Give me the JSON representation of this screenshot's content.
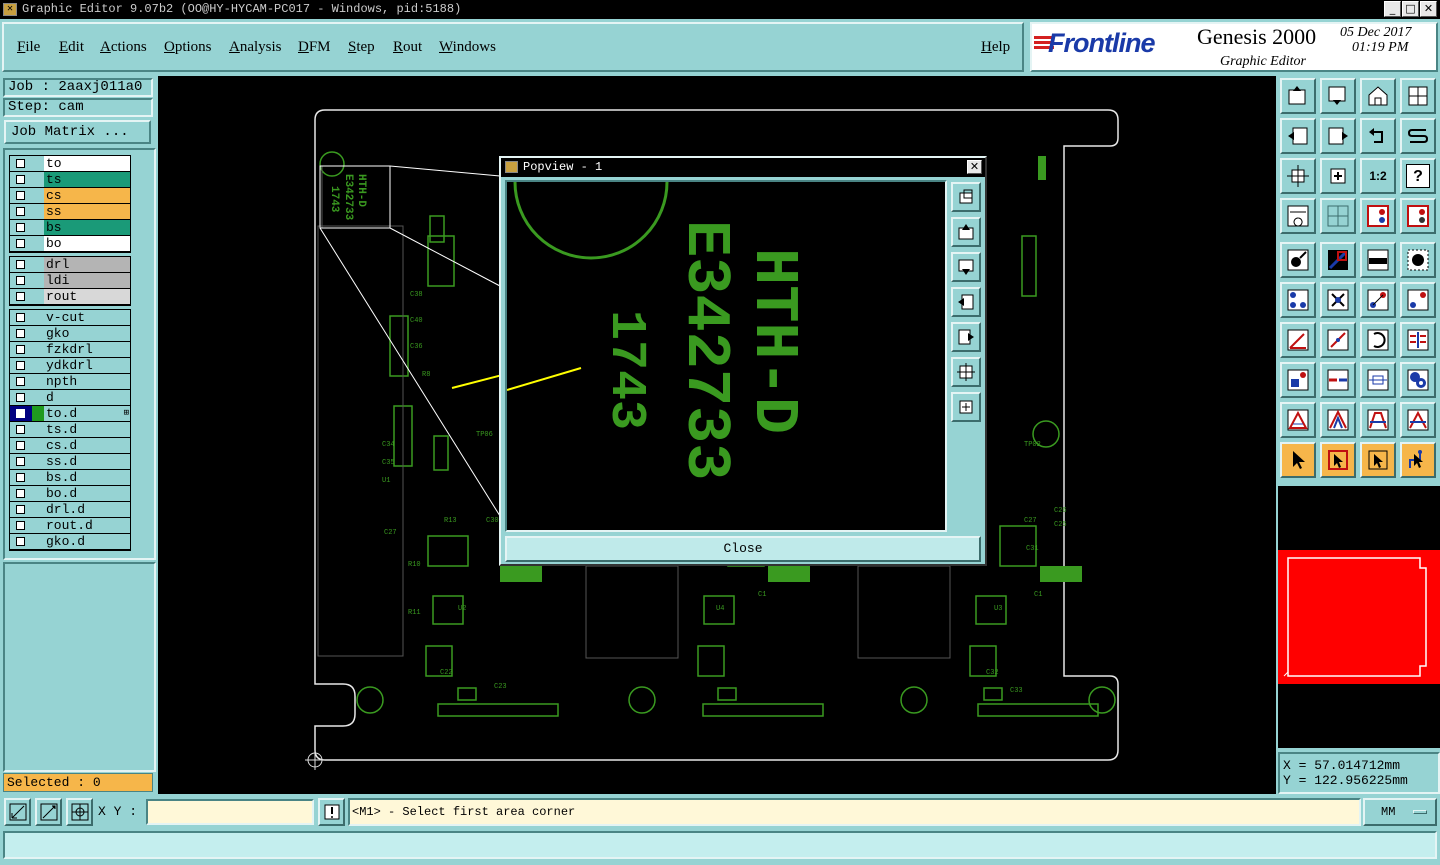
{
  "window": {
    "title": "Graphic Editor 9.07b2 (OO@HY-HYCAM-PC017 - Windows, pid:5188)"
  },
  "menu": {
    "items": [
      "File",
      "Edit",
      "Actions",
      "Options",
      "Analysis",
      "DFM",
      "Step",
      "Rout",
      "Windows"
    ],
    "help": "Help"
  },
  "brand": {
    "logo": "Frontline",
    "product": "Genesis 2000",
    "module": "Graphic Editor",
    "date": "05 Dec 2017",
    "time": "01:19 PM"
  },
  "job": {
    "name": "Job : 2aaxj011a0",
    "step": "Step: cam",
    "matrix_button": "Job Matrix ..."
  },
  "layers": {
    "group1": [
      {
        "name": "to",
        "color": "white"
      },
      {
        "name": "ts",
        "color": "green"
      },
      {
        "name": "cs",
        "color": "orange"
      },
      {
        "name": "ss",
        "color": "orange"
      },
      {
        "name": "bs",
        "color": "green"
      },
      {
        "name": "bo",
        "color": "white"
      }
    ],
    "group2": [
      {
        "name": "drl",
        "color": "gray"
      },
      {
        "name": "ldi",
        "color": "gray"
      },
      {
        "name": "rout",
        "color": "lgray"
      }
    ],
    "group3": [
      {
        "name": "v-cut"
      },
      {
        "name": "gko"
      },
      {
        "name": "fzkdrl"
      },
      {
        "name": "ydkdrl"
      },
      {
        "name": "npth"
      },
      {
        "name": "d"
      },
      {
        "name": "to.d",
        "selected": true
      },
      {
        "name": "ts.d"
      },
      {
        "name": "cs.d"
      },
      {
        "name": "ss.d"
      },
      {
        "name": "bs.d"
      },
      {
        "name": "bo.d"
      },
      {
        "name": "drl.d"
      },
      {
        "name": "rout.d"
      },
      {
        "name": "gko.d"
      }
    ]
  },
  "selected": "Selected : 0",
  "canvas": {
    "board_texts": [
      "HTH-D",
      "E342733",
      "1743"
    ]
  },
  "popview": {
    "title": "Popview - 1",
    "text_line1": "HTH-D",
    "text_line2": "E342733",
    "text_line3": "1743",
    "close": "Close"
  },
  "coords": {
    "x": "X  =  57.014712mm",
    "y": "Y  = 122.956225mm"
  },
  "bottom": {
    "xy_label": "X Y :",
    "xy_value": "",
    "message": "<M1> - Select first area corner",
    "units": "MM"
  },
  "colors": {
    "panel": "#96d3d3",
    "pcb_green": "#3a9a20",
    "accent_orange": "#f6b64a",
    "overview_red": "#ff0000",
    "arrow": "#ffff00"
  }
}
